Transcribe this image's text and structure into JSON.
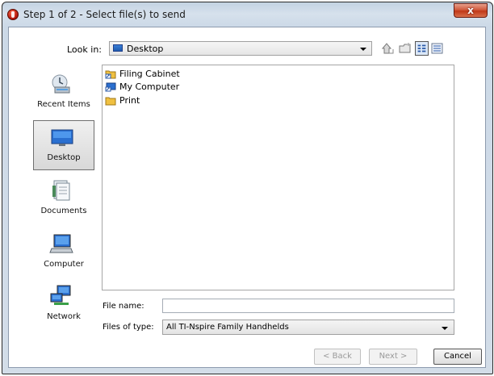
{
  "window": {
    "title": "Step 1 of 2 - Select file(s) to send",
    "close_label": "x"
  },
  "lookin": {
    "label": "Look in:",
    "value": "Desktop"
  },
  "places": [
    {
      "label": "Recent Items",
      "icon": "recent-items-icon",
      "selected": false
    },
    {
      "label": "Desktop",
      "icon": "desktop-icon",
      "selected": true
    },
    {
      "label": "Documents",
      "icon": "documents-icon",
      "selected": false
    },
    {
      "label": "Computer",
      "icon": "computer-icon",
      "selected": false
    },
    {
      "label": "Network",
      "icon": "network-icon",
      "selected": false
    }
  ],
  "files": [
    {
      "name": "Filing Cabinet",
      "icon": "shortcut-folder-icon"
    },
    {
      "name": "My Computer",
      "icon": "computer-shortcut-icon"
    },
    {
      "name": "Print",
      "icon": "folder-icon"
    }
  ],
  "filename": {
    "label": "File name:",
    "value": ""
  },
  "filetype": {
    "label": "Files of type:",
    "value": "All TI-Nspire Family Handhelds"
  },
  "buttons": {
    "back": "< Back",
    "next": "Next >",
    "cancel": "Cancel"
  },
  "colors": {
    "accent": "#3a7fd6",
    "close": "#c03818"
  }
}
